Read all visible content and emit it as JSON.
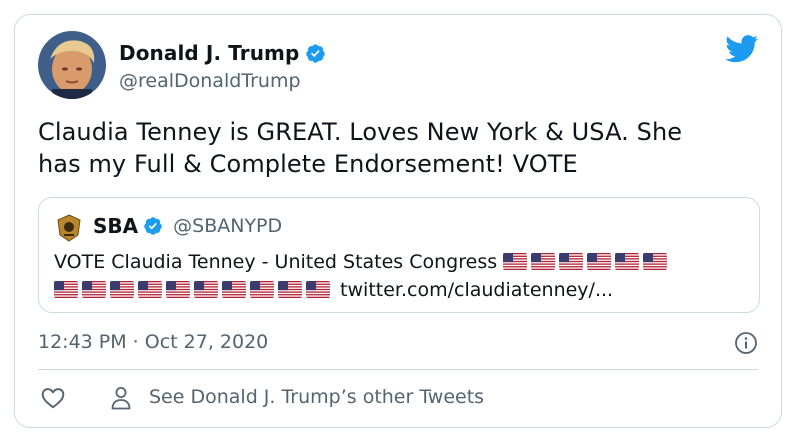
{
  "tweet": {
    "author_name": "Donald J. Trump",
    "author_handle": "@realDonaldTrump",
    "text_line1": "Claudia Tenney is GREAT. Loves New York & USA. She",
    "text_line2": "has my Full & Complete Endorsement! VOTE",
    "timestamp": "12:43 PM · Oct 27, 2020"
  },
  "quoted": {
    "name": "SBA",
    "handle": "@SBANYPD",
    "text": "VOTE Claudia Tenney - United States Congress",
    "link": "twitter.com/claudiatenney/...",
    "flags_line1_count": 6,
    "flags_line2_count": 10
  },
  "footer": {
    "other_tweets_label": "See Donald J. Trump’s other Tweets"
  },
  "icons": {
    "brand": "twitter-bird-icon",
    "verified": "verified-badge-icon",
    "info": "info-icon",
    "like": "heart-icon",
    "person": "person-icon",
    "flag": "us-flag-emoji"
  },
  "colors": {
    "twitter_blue": "#1d9bf0",
    "secondary_text": "#536471",
    "border": "#cfd9de"
  }
}
